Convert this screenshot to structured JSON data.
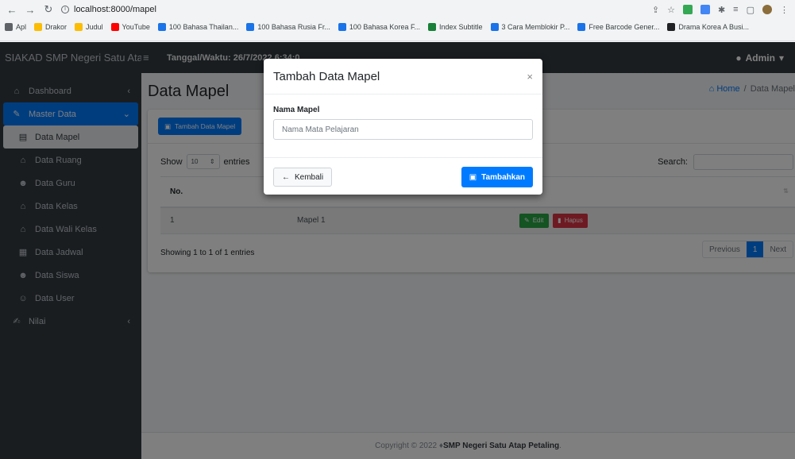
{
  "browser": {
    "url": "localhost:8000/mapel",
    "bookmarks": [
      {
        "label": "Apl",
        "color": "#5f6368"
      },
      {
        "label": "Drakor",
        "color": "#fbbc04"
      },
      {
        "label": "Judul",
        "color": "#fbbc04"
      },
      {
        "label": "YouTube",
        "color": "#ff0000"
      },
      {
        "label": "100 Bahasa Thailan...",
        "color": "#1a73e8"
      },
      {
        "label": "100 Bahasa Rusia Fr...",
        "color": "#1a73e8"
      },
      {
        "label": "100 Bahasa Korea F...",
        "color": "#1a73e8"
      },
      {
        "label": "Index Subtitle",
        "color": "#188038"
      },
      {
        "label": "3 Cara Memblokir P...",
        "color": "#1a73e8"
      },
      {
        "label": "Free Barcode Gener...",
        "color": "#1a73e8"
      },
      {
        "label": "Drama Korea A Busi...",
        "color": "#202124"
      }
    ]
  },
  "navbar": {
    "brand": "SIAKAD SMP Negeri Satu Atap",
    "datetime": "Tanggal/Waktu: 26/7/2022 6:34:0",
    "user": "Admin"
  },
  "sidebar": {
    "items": [
      {
        "label": "Dashboard",
        "icon": "home-icon",
        "glyph": "⌂"
      },
      {
        "label": "Master Data",
        "icon": "edit-icon",
        "glyph": "✎"
      },
      {
        "label": "Data Mapel",
        "icon": "book-icon",
        "glyph": "▤"
      },
      {
        "label": "Data Ruang",
        "icon": "home-icon",
        "glyph": "⌂"
      },
      {
        "label": "Data Guru",
        "icon": "users-icon",
        "glyph": "☻"
      },
      {
        "label": "Data Kelas",
        "icon": "home-icon",
        "glyph": "⌂"
      },
      {
        "label": "Data Wali Kelas",
        "icon": "home-icon",
        "glyph": "⌂"
      },
      {
        "label": "Data Jadwal",
        "icon": "calendar-icon",
        "glyph": "▦"
      },
      {
        "label": "Data Siswa",
        "icon": "users-icon",
        "glyph": "☻"
      },
      {
        "label": "Data User",
        "icon": "user-plus-icon",
        "glyph": "☺"
      },
      {
        "label": "Nilai",
        "icon": "signature-icon",
        "glyph": "✍"
      }
    ]
  },
  "page": {
    "title": "Data Mapel",
    "breadcrumb_home": "Home",
    "breadcrumb_sep": "/",
    "breadcrumb_current": "Data Mapel"
  },
  "card": {
    "add_button": "Tambah Data Mapel",
    "show_label": "Show",
    "entries_value": "10",
    "entries_label": "entries",
    "search_label": "Search:",
    "table_headers": [
      "No.",
      "",
      ""
    ],
    "rows": [
      {
        "no": "1",
        "name": "Mapel 1"
      }
    ],
    "edit_label": "Edit",
    "delete_label": "Hapus",
    "showing_text": "Showing 1 to 1 of 1 entries",
    "pager": {
      "previous": "Previous",
      "current": "1",
      "next": "Next"
    }
  },
  "footer": {
    "prefix": "Copyright © 2022 ♦ ",
    "name": "SMP Negeri Satu Atap Petaling",
    "suffix": "."
  },
  "modal": {
    "title": "Tambah Data Mapel",
    "close": "×",
    "field_label": "Nama Mapel",
    "field_placeholder": "Nama Mata Pelajaran",
    "back_label": "Kembali",
    "submit_label": "Tambahkan"
  }
}
